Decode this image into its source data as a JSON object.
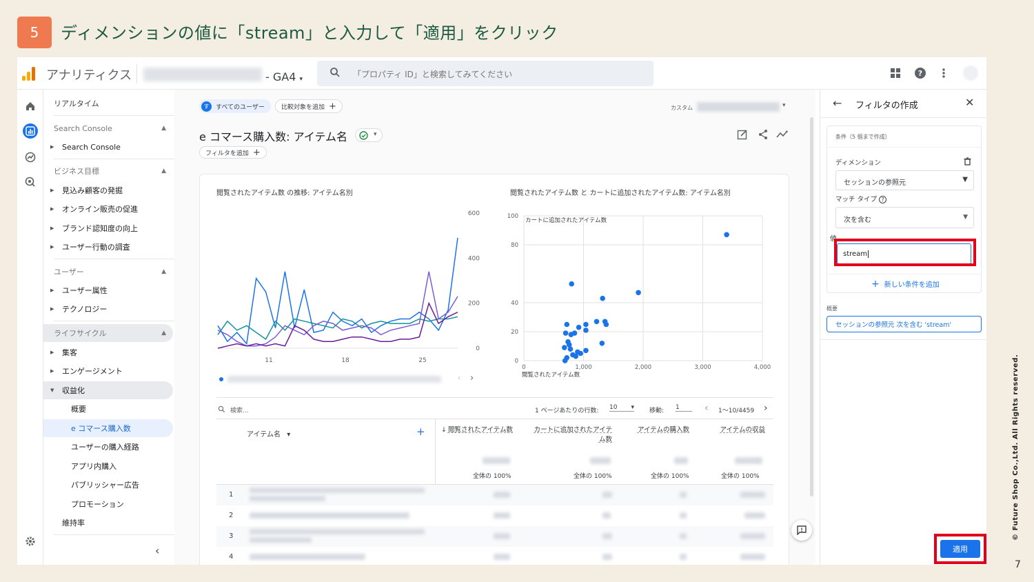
{
  "slide": {
    "step_number": "5",
    "title": "ディメンションの値に「stream」と入力して「適用」をクリック",
    "copyright": "© Future Shop Co.,Ltd. All Rights reserved.",
    "page_number": "7"
  },
  "topbar": {
    "app_name": "アナリティクス",
    "property_suffix": "- GA4",
    "search_placeholder": "「プロパティ ID」と検索してみてください"
  },
  "sidebar": {
    "realtime": "リアルタイム",
    "search_console_section": "Search Console",
    "search_console_item": "Search Console",
    "business_section": "ビジネス目標",
    "business_items": [
      "見込み顧客の発掘",
      "オンライン販売の促進",
      "ブランド認知度の向上",
      "ユーザー行動の調査"
    ],
    "user_section": "ユーザー",
    "user_items": [
      "ユーザー属性",
      "テクノロジー"
    ],
    "lifecycle_section": "ライフサイクル",
    "lifecycle_items": [
      "集客",
      "エンゲージメント",
      "収益化"
    ],
    "monetization_items": [
      "概要",
      "e コマース購入数",
      "ユーザーの購入経路",
      "アプリ内購入",
      "パブリッシャー広告",
      "プロモーション"
    ],
    "retention": "維持率"
  },
  "report": {
    "all_users_chip": "すべてのユーザー",
    "all_users_avatar": "す",
    "compare_chip": "比較対象を追加",
    "custom_label": "カスタム",
    "title": "e コマース購入数: アイテム名",
    "filter_chip": "フィルタを追加",
    "search_placeholder": "検索...",
    "rows_per_page_label": "1 ページあたりの行数:",
    "rows_per_page": "10",
    "goto_label": "移動:",
    "goto_value": "1",
    "pagination": "1～10/4459",
    "table": {
      "dim_header": "アイテム名",
      "metric_headers": [
        "閲覧されたアイテム数",
        "カートに追加されたアイテム数",
        "アイテムの購入数",
        "アイテムの収益"
      ],
      "total_label": "全体の 100%",
      "row_numbers": [
        "1",
        "2",
        "3",
        "4"
      ]
    }
  },
  "chart_data": [
    {
      "type": "line",
      "title": "閲覧されたアイテム数 の推移: アイテム名別",
      "x_tick_labels": [
        "11",
        "18",
        "25"
      ],
      "y_tick_labels": [
        "0",
        "200",
        "400",
        "600"
      ],
      "ylim": [
        0,
        600
      ],
      "series": [
        {
          "color": "#1a73e8",
          "values": [
            100,
            30,
            70,
            20,
            310,
            250,
            90,
            340,
            90,
            260,
            70,
            80,
            160,
            120,
            100,
            130,
            70,
            100,
            120,
            130,
            130,
            160,
            130,
            80,
            170,
            490
          ]
        },
        {
          "color": "#12939a",
          "values": [
            60,
            120,
            80,
            100,
            70,
            40,
            120,
            80,
            130,
            120,
            110,
            100,
            90,
            130,
            120,
            90,
            110,
            120,
            110,
            110,
            110,
            130,
            120,
            130,
            130,
            140
          ]
        },
        {
          "color": "#7b5cd6",
          "values": [
            80,
            60,
            30,
            10,
            10,
            20,
            50,
            100,
            80,
            60,
            100,
            120,
            110,
            80,
            90,
            100,
            90,
            60,
            80,
            90,
            100,
            110,
            340,
            130,
            160,
            230
          ]
        },
        {
          "color": "#6a1b9a",
          "values": [
            0,
            10,
            20,
            10,
            20,
            10,
            20,
            10,
            100,
            80,
            40,
            30,
            30,
            40,
            50,
            50,
            40,
            30,
            30,
            40,
            40,
            50,
            200,
            110,
            140,
            160
          ]
        }
      ]
    },
    {
      "type": "scatter",
      "title": "閲覧されたアイテム数 と カートに追加されたアイテム数: アイテム名別",
      "xlabel": "閲覧されたアイテム数",
      "ylabel": "カートに追加されたアイテム数",
      "x_tick_labels": [
        "0",
        "1,000",
        "2,000",
        "3,000",
        "4,000"
      ],
      "y_tick_labels": [
        "0",
        "20",
        "40",
        "80",
        "100"
      ],
      "xlim": [
        0,
        4000
      ],
      "ylim": [
        0,
        100
      ],
      "point_color": "#1a73e8",
      "points": [
        [
          3400,
          87
        ],
        [
          800,
          53
        ],
        [
          1320,
          43
        ],
        [
          1920,
          47
        ],
        [
          720,
          25
        ],
        [
          1040,
          25
        ],
        [
          1360,
          27
        ],
        [
          1380,
          25
        ],
        [
          1220,
          27
        ],
        [
          920,
          23
        ],
        [
          850,
          19
        ],
        [
          790,
          18
        ],
        [
          1040,
          21
        ],
        [
          700,
          19
        ],
        [
          740,
          13
        ],
        [
          1310,
          12
        ],
        [
          760,
          11
        ],
        [
          780,
          8
        ],
        [
          900,
          6
        ],
        [
          950,
          5
        ],
        [
          1040,
          7
        ],
        [
          680,
          9
        ],
        [
          820,
          4
        ],
        [
          720,
          2
        ],
        [
          690,
          0
        ],
        [
          870,
          3
        ]
      ]
    }
  ],
  "filter_panel": {
    "title": "フィルタの作成",
    "condition_header": "条件（5 個まで作成）",
    "dimension_label": "ディメンション",
    "dimension_value": "セッションの参照元",
    "match_type_label": "マッチ タイプ",
    "match_type_value": "次を含む",
    "value_label": "値",
    "value_input": "stream",
    "add_condition": "新しい条件を追加",
    "summary_label": "概要",
    "summary_value": "セッションの参照元 次を含む 'stream'",
    "apply_button": "適用"
  }
}
